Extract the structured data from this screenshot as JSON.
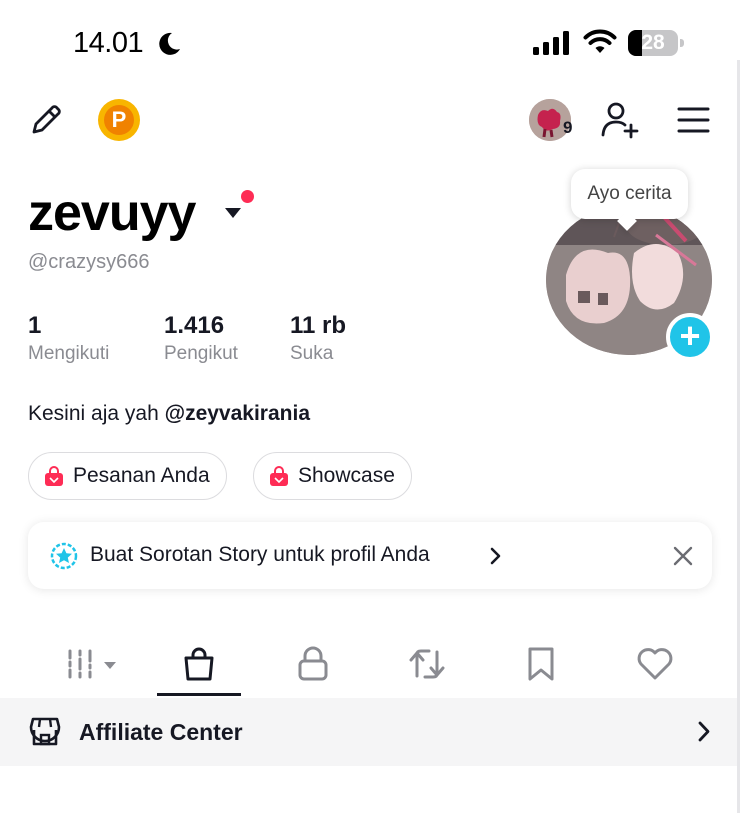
{
  "status_bar": {
    "time": "14.01",
    "battery_level": "28",
    "battery_fraction": 0.28,
    "icons": [
      "moon-icon",
      "cellular-signal-icon",
      "wifi-icon",
      "battery-icon"
    ]
  },
  "header": {
    "icons": [
      "pencil-icon",
      "coin-icon",
      "avatar",
      "add-user-icon",
      "menu-icon"
    ],
    "coin_letter": "P",
    "avatar_count": "9"
  },
  "profile": {
    "username": "zevuyy",
    "handle": "@crazysy666",
    "stats": [
      {
        "value": "1",
        "label": "Mengikuti"
      },
      {
        "value": "1.416",
        "label": "Pengikut"
      },
      {
        "value": "11 rb",
        "label": "Suka"
      }
    ],
    "bio_prefix": "Kesini aja yah ",
    "bio_mention": "@zeyvakirania",
    "story_bubble": "Ayo cerita",
    "accent_red": "#fe2c55",
    "accent_cyan": "#20c4e8"
  },
  "pills": [
    {
      "label": "Pesanan Anda",
      "icon": "shopping-bag-icon"
    },
    {
      "label": "Showcase",
      "icon": "shopping-bag-icon"
    }
  ],
  "banner": {
    "text": "Buat Sorotan Story untuk profil Anda",
    "icons": [
      "star-badge-icon",
      "chevron-right-icon",
      "close-icon"
    ]
  },
  "tabs": [
    {
      "name": "videos",
      "icon": "grid-filter-icon",
      "active": false
    },
    {
      "name": "shop",
      "icon": "shopping-bag-icon",
      "active": true
    },
    {
      "name": "private",
      "icon": "lock-icon",
      "active": false
    },
    {
      "name": "reposts",
      "icon": "repost-icon",
      "active": false
    },
    {
      "name": "favorites",
      "icon": "bookmark-icon",
      "active": false
    },
    {
      "name": "liked",
      "icon": "heart-icon",
      "active": false
    }
  ],
  "affiliate": {
    "label": "Affiliate Center",
    "icon": "storefront-icon"
  }
}
